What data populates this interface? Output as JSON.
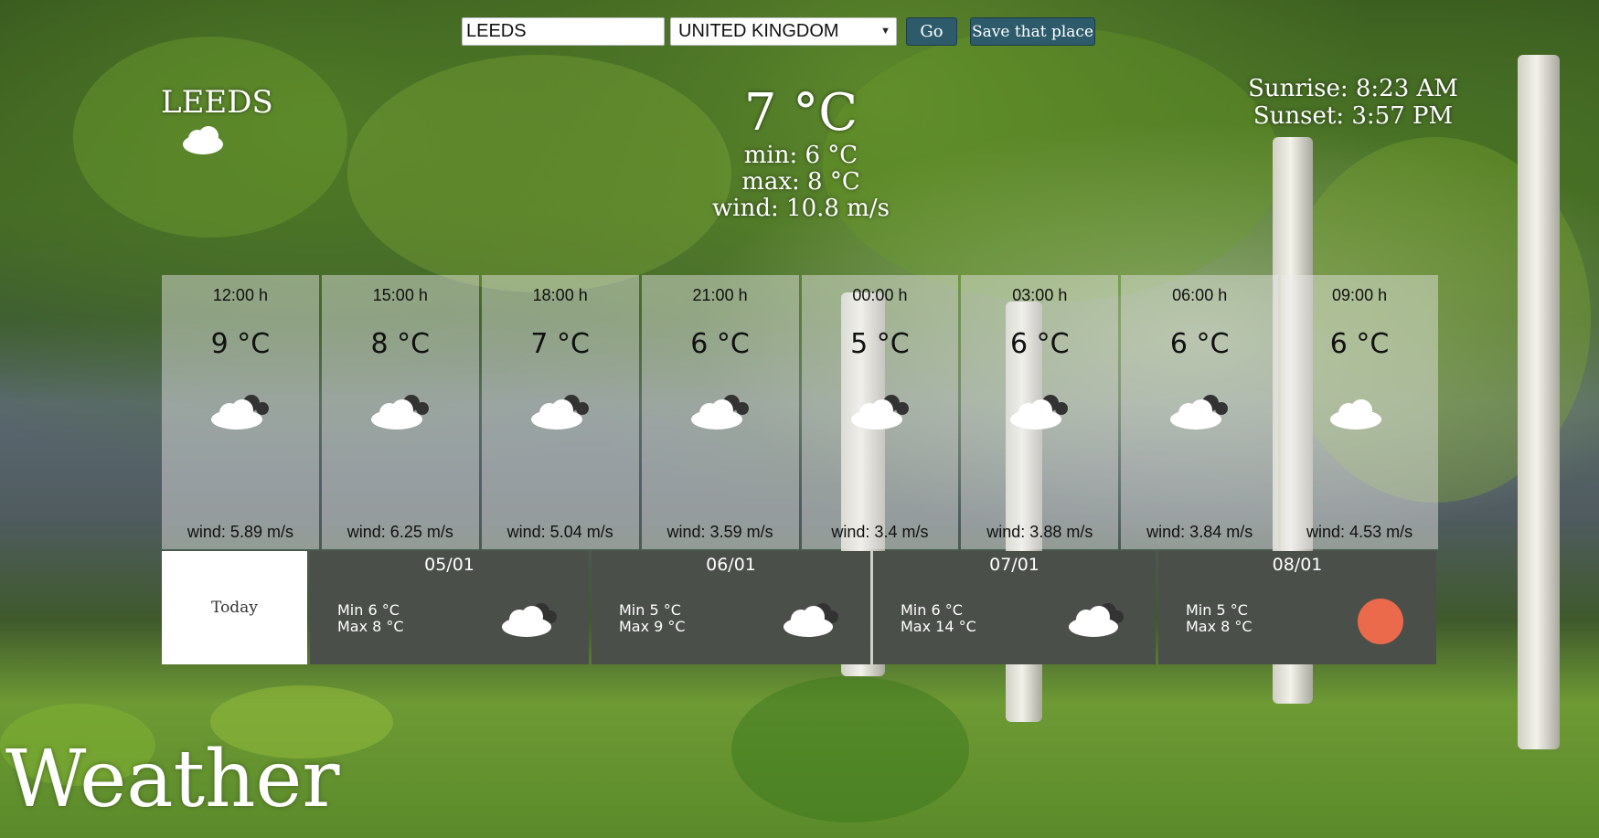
{
  "search": {
    "city_value": "LEEDS",
    "country_value": "UNITED KINGDOM",
    "go_label": "Go",
    "save_label": "Save that place"
  },
  "current": {
    "city": "LEEDS",
    "icon": "cloud-icon",
    "temp": "7 °C",
    "min": "min: 6 °C",
    "max": "max: 8 °C",
    "wind": "wind: 10.8 m/s",
    "sunrise": "Sunrise: 8:23 AM",
    "sunset": "Sunset: 3:57 PM"
  },
  "hourly": [
    {
      "time": "12:00 h",
      "temp": "9 °C",
      "icon": "partly-cloudy-icon",
      "wind": "wind: 5.89 m/s"
    },
    {
      "time": "15:00 h",
      "temp": "8 °C",
      "icon": "partly-cloudy-icon",
      "wind": "wind: 6.25 m/s"
    },
    {
      "time": "18:00 h",
      "temp": "7 °C",
      "icon": "partly-cloudy-icon",
      "wind": "wind: 5.04 m/s"
    },
    {
      "time": "21:00 h",
      "temp": "6 °C",
      "icon": "partly-cloudy-icon",
      "wind": "wind: 3.59 m/s"
    },
    {
      "time": "00:00 h",
      "temp": "5 °C",
      "icon": "partly-cloudy-icon",
      "wind": "wind: 3.4 m/s"
    },
    {
      "time": "03:00 h",
      "temp": "6 °C",
      "icon": "partly-cloudy-icon",
      "wind": "wind: 3.88 m/s"
    },
    {
      "time": "06:00 h",
      "temp": "6 °C",
      "icon": "partly-cloudy-icon",
      "wind": "wind: 3.84 m/s"
    },
    {
      "time": "09:00 h",
      "temp": "6 °C",
      "icon": "cloud-icon",
      "wind": "wind: 4.53 m/s"
    }
  ],
  "daily": {
    "today_label": "Today",
    "days": [
      {
        "date": "05/01",
        "min": "Min 6 °C",
        "max": "Max 8 °C",
        "icon": "partly-cloudy-icon"
      },
      {
        "date": "06/01",
        "min": "Min 5 °C",
        "max": "Max 9 °C",
        "icon": "partly-cloudy-icon"
      },
      {
        "date": "07/01",
        "min": "Min 6 °C",
        "max": "Max 14 °C",
        "icon": "partly-cloudy-icon"
      },
      {
        "date": "08/01",
        "min": "Min 5 °C",
        "max": "Max 8 °C",
        "icon": "sun-icon"
      }
    ]
  },
  "app_title": "Weather",
  "colors": {
    "button": "#2d5b6b",
    "day_card": "#4b4f4a",
    "sun": "#eb6a4c"
  }
}
